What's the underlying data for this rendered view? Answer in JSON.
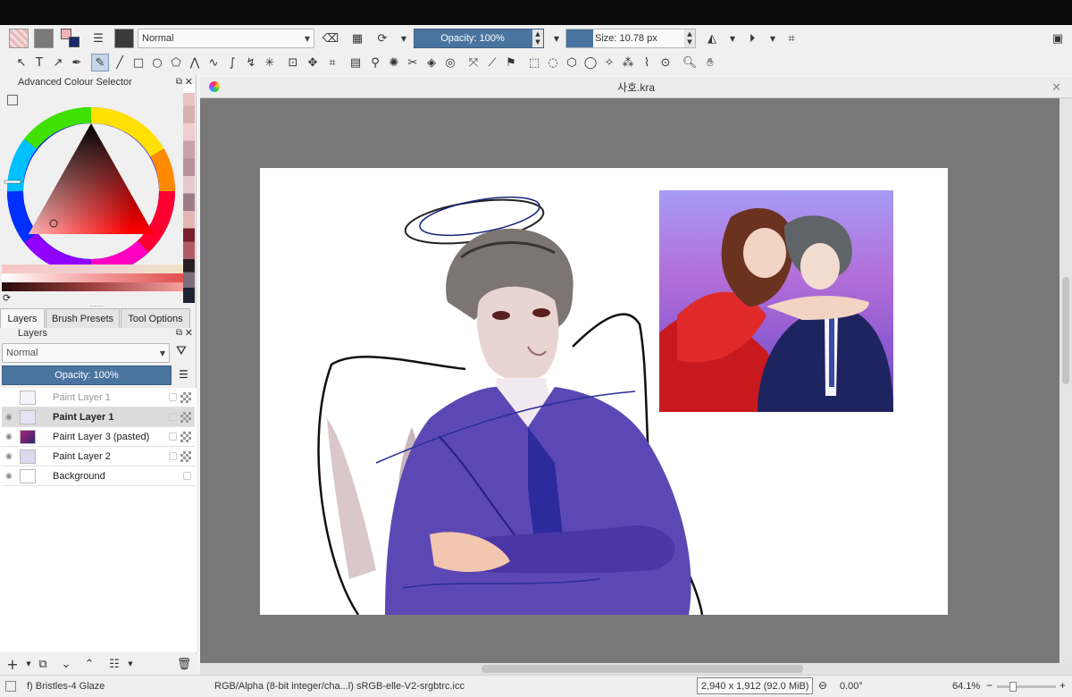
{
  "toolbar": {
    "blend_mode": "Normal",
    "opacity_label": "Opacity: 100%",
    "size_label": "Size: 10.78 px"
  },
  "colour_selector": {
    "title": "Advanced Colour Selector"
  },
  "panel_tabs": [
    "Layers",
    "Brush Presets",
    "Tool Options"
  ],
  "layers_panel": {
    "title": "Layers",
    "blend_mode": "Normal",
    "opacity_label": "Opacity:  100%",
    "layers": [
      {
        "name": "Paint Layer 1",
        "visible": false,
        "selected": false
      },
      {
        "name": "Paint Layer 1",
        "visible": true,
        "selected": true
      },
      {
        "name": "Paint Layer 3 (pasted)",
        "visible": true,
        "selected": false
      },
      {
        "name": "Paint Layer 2",
        "visible": true,
        "selected": false
      },
      {
        "name": "Background",
        "visible": true,
        "selected": false
      }
    ]
  },
  "document": {
    "title": "사호.kra"
  },
  "status": {
    "brush": "f) Bristles-4 Glaze",
    "color_model": "RGB/Alpha (8-bit integer/cha...l)  sRGB-elle-V2-srgbtrc.icc",
    "dimensions": "2,940 x 1,912 (92.0 MiB)",
    "rotation": "0.00°",
    "zoom": "64.1%"
  },
  "colors": {
    "accent": "#4a74a0",
    "canvas_bg": "#787878",
    "topbar": "#0b0b0b"
  }
}
